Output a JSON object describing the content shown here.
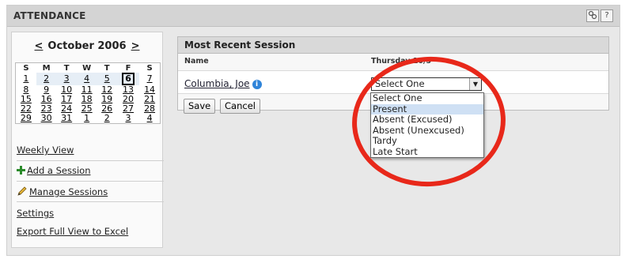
{
  "header": {
    "title": "ATTENDANCE",
    "icons": [
      "settings-icon",
      "help-icon"
    ],
    "help_glyph": "?"
  },
  "calendar": {
    "prev": "<",
    "month_label": "October 2006",
    "next": ">",
    "weekdays": [
      "S",
      "M",
      "T",
      "W",
      "T",
      "F",
      "S"
    ],
    "weeks": [
      [
        "1",
        "2",
        "3",
        "4",
        "5",
        "6",
        "7"
      ],
      [
        "8",
        "9",
        "10",
        "11",
        "12",
        "13",
        "14"
      ],
      [
        "15",
        "16",
        "17",
        "18",
        "19",
        "20",
        "21"
      ],
      [
        "22",
        "23",
        "24",
        "25",
        "26",
        "27",
        "28"
      ],
      [
        "29",
        "30",
        "31",
        "1",
        "2",
        "3",
        "4"
      ]
    ],
    "today": "6"
  },
  "sidebar": {
    "weekly_view": "Weekly View",
    "add_session": "Add a Session",
    "manage_sessions": "Manage Sessions",
    "settings": "Settings",
    "export": "Export Full View to Excel"
  },
  "session": {
    "title": "Most Recent Session",
    "col_name": "Name",
    "col_date": "Thursday 10/5",
    "student": "Columbia, Joe",
    "info_glyph": "i",
    "select_value": "Select One",
    "save": "Save",
    "cancel": "Cancel",
    "options": [
      "Select One",
      "Present",
      "Absent (Excused)",
      "Absent (Unexcused)",
      "Tardy",
      "Late Start"
    ],
    "highlighted_option": "Present"
  },
  "colors": {
    "annotation_circle": "#e8281a",
    "highlight": "#cfe0f4",
    "info_blue": "#2f84d9",
    "plus_green": "#2a8a2a"
  }
}
